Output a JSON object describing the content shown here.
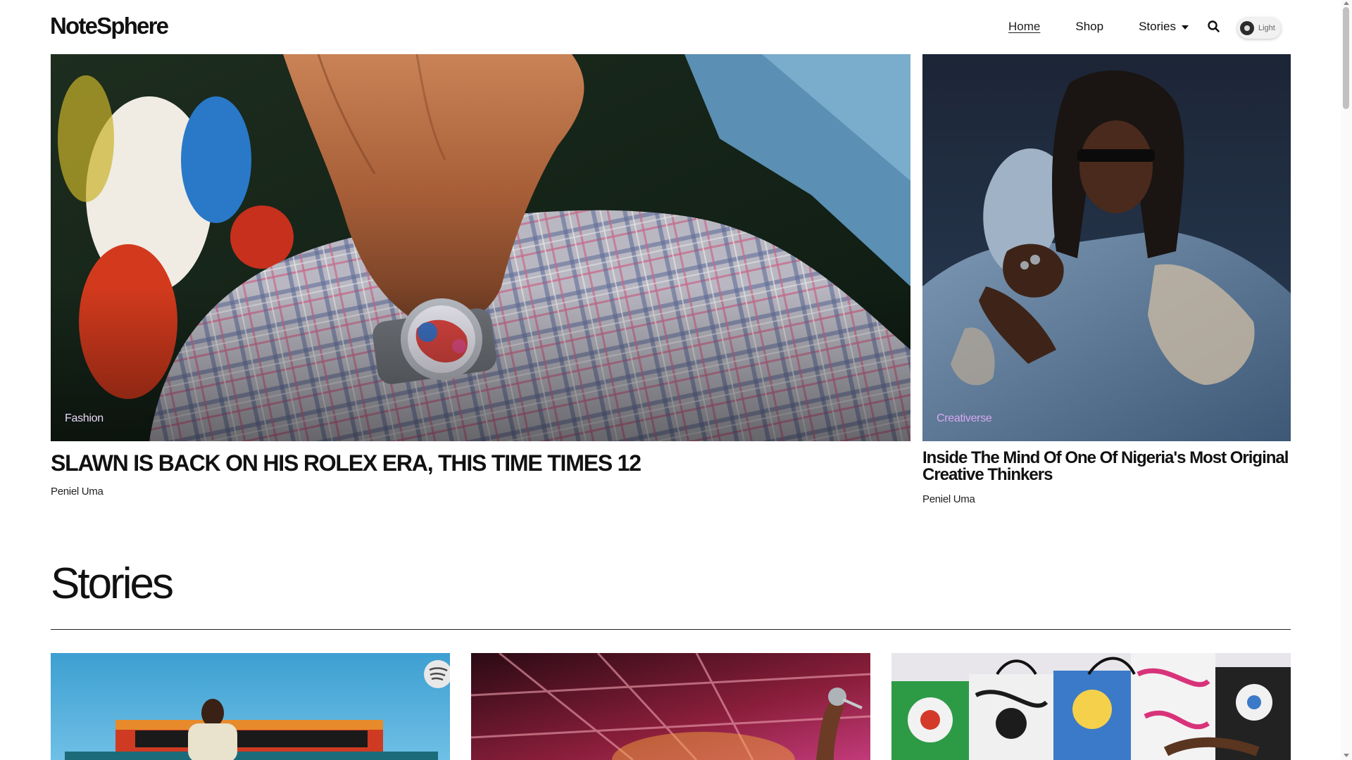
{
  "site": {
    "logo": "NoteSphere"
  },
  "nav": {
    "items": [
      {
        "label": "Home",
        "active": true
      },
      {
        "label": "Shop",
        "active": false
      },
      {
        "label": "Stories",
        "active": false,
        "has_dropdown": true
      }
    ],
    "search_icon": "search-icon",
    "theme_toggle": {
      "label": "Light",
      "icon": "sun-icon"
    }
  },
  "hero": {
    "main": {
      "category": "Fashion",
      "title": "SLAWN IS BACK ON HIS ROLEX ERA, THIS TIME TIMES 12",
      "author": "Peniel Uma"
    },
    "side": {
      "category": "Creativerse",
      "title": "Inside The Mind Of One Of Nigeria's Most Original Creative Thinkers",
      "author": "Peniel Uma"
    }
  },
  "stories": {
    "heading": "Stories",
    "cards": [
      {
        "image": "afronation-stage-photo"
      },
      {
        "image": "concert-microphone-photo"
      },
      {
        "image": "painted-bags-photo"
      }
    ]
  },
  "colors": {
    "text": "#111111",
    "fashion_label": "#e9d8f6",
    "creativerse_label": "#d8a8f0",
    "background": "#ffffff"
  }
}
